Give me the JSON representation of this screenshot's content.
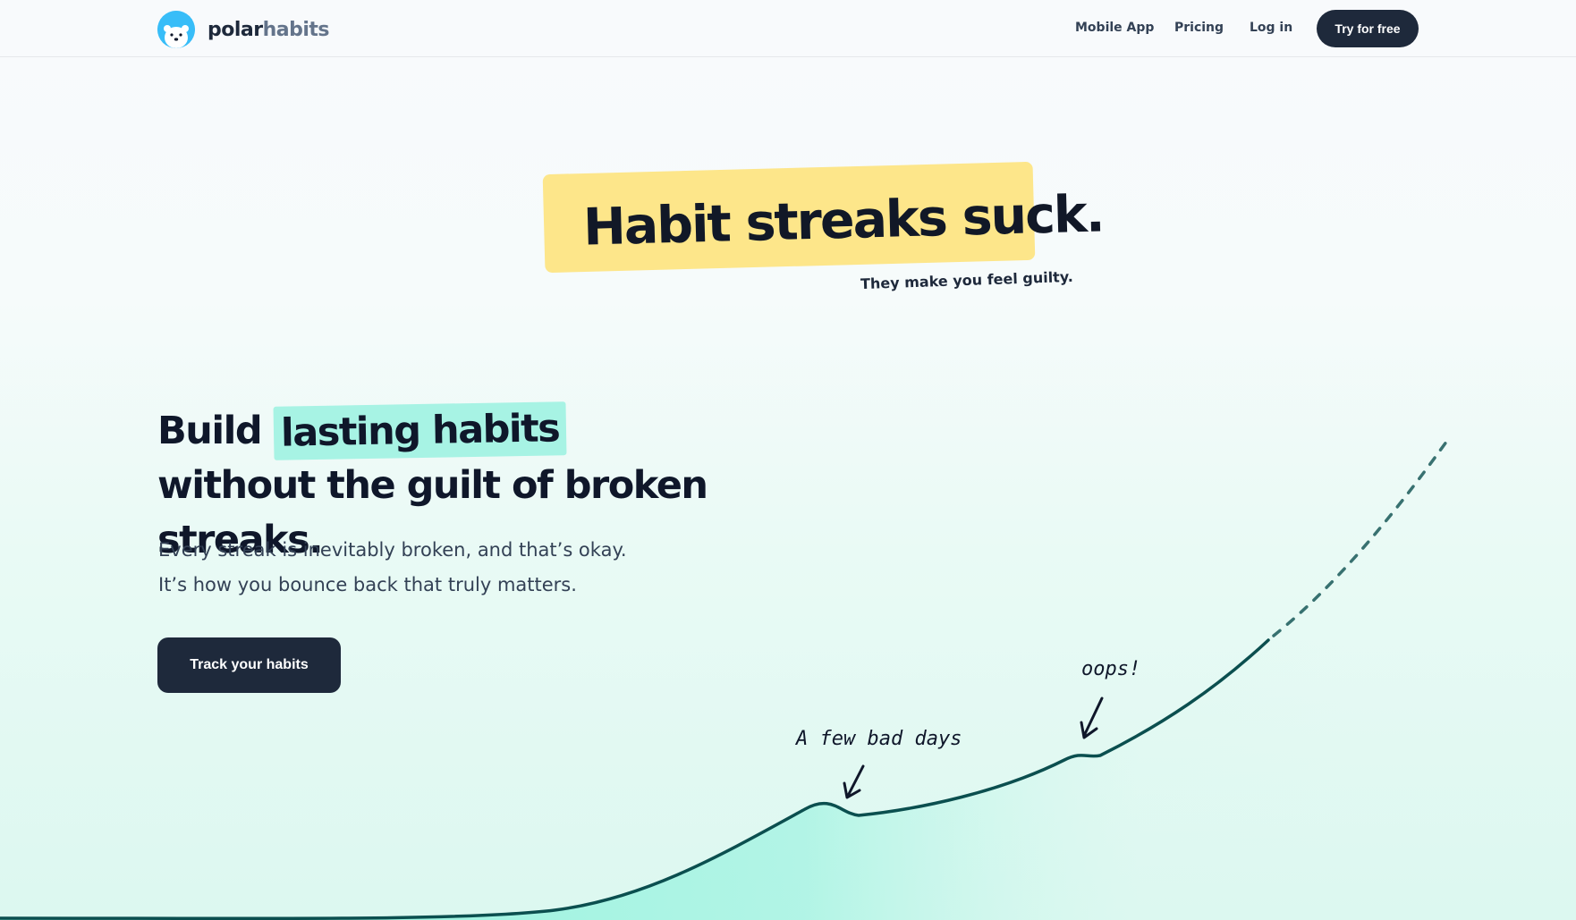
{
  "brand": {
    "name_part1": "polar",
    "name_part2": "habits",
    "logo_icon": "polar-bear-icon"
  },
  "nav": {
    "links": [
      "Mobile App",
      "Pricing",
      "Log in"
    ],
    "cta": "Try for free"
  },
  "hero": {
    "tag_title": "Habit streaks suck.",
    "tag_sub": "They make you feel guilty.",
    "headline_pre": "Build",
    "headline_highlight": "lasting habits",
    "headline_post": "without the guilt of broken streaks.",
    "sub1": "Every streak is inevitably broken, and that’s okay.",
    "sub2": "It’s how you bounce back that truly matters.",
    "cta": "Track your habits"
  },
  "chart": {
    "annotation_1": "A few bad days",
    "annotation_2": "oops!",
    "line_color": "#0b4f4f",
    "fill_color": "#7ff0d8"
  }
}
